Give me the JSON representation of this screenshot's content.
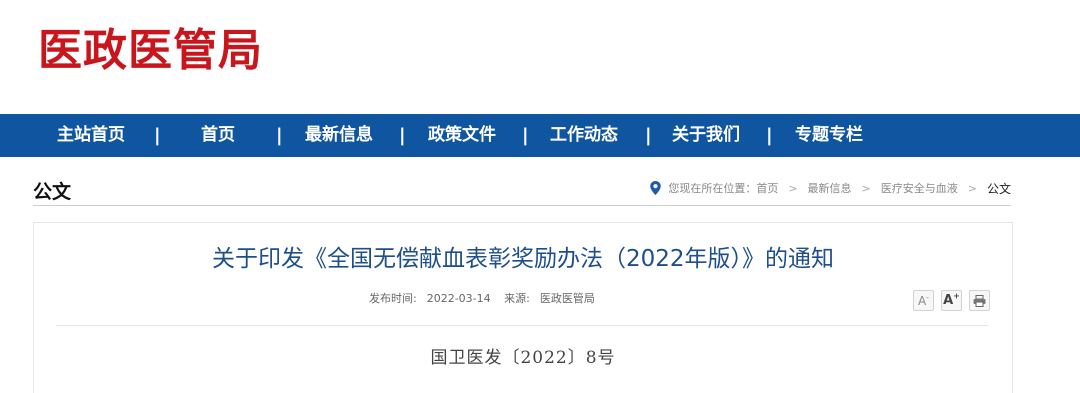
{
  "site": {
    "logo_text": "医政医管局",
    "brand_color": "#c9161d",
    "nav_color": "#10559f"
  },
  "nav": {
    "items": [
      {
        "label": "主站首页"
      },
      {
        "label": "首页"
      },
      {
        "label": "最新信息"
      },
      {
        "label": "政策文件"
      },
      {
        "label": "工作动态"
      },
      {
        "label": "关于我们"
      },
      {
        "label": "专题专栏"
      }
    ],
    "separator": "|"
  },
  "section": {
    "title": "公文"
  },
  "breadcrumb": {
    "prefix": "您现在所在位置：",
    "items": [
      "首页",
      "最新信息",
      "医疗安全与血液"
    ],
    "current": "公文",
    "separator": ">",
    "icon": "location-pin-icon"
  },
  "article": {
    "title": "关于印发《全国无偿献血表彰奖励办法（2022年版）》的通知",
    "publish_label": "发布时间:",
    "publish_date": "2022-03-14",
    "source_label": "来源:",
    "source": "医政医管局",
    "doc_number": "国卫医发〔2022〕8号",
    "tools": {
      "font_small_label": "A",
      "font_large_label": "A",
      "font_plus": "+",
      "font_minus": "-",
      "print_icon": "print-icon"
    }
  }
}
